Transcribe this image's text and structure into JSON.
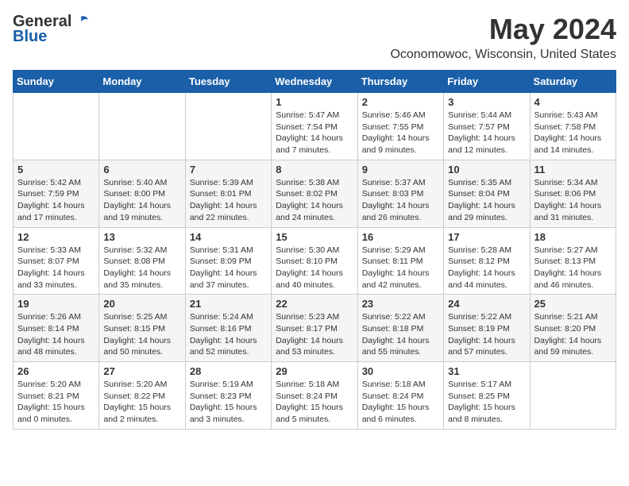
{
  "app": {
    "name_general": "General",
    "name_blue": "Blue"
  },
  "title": "May 2024",
  "location": "Oconomowoc, Wisconsin, United States",
  "days_of_week": [
    "Sunday",
    "Monday",
    "Tuesday",
    "Wednesday",
    "Thursday",
    "Friday",
    "Saturday"
  ],
  "weeks": [
    [
      {
        "day": "",
        "info": ""
      },
      {
        "day": "",
        "info": ""
      },
      {
        "day": "",
        "info": ""
      },
      {
        "day": "1",
        "info": "Sunrise: 5:47 AM\nSunset: 7:54 PM\nDaylight: 14 hours\nand 7 minutes."
      },
      {
        "day": "2",
        "info": "Sunrise: 5:46 AM\nSunset: 7:55 PM\nDaylight: 14 hours\nand 9 minutes."
      },
      {
        "day": "3",
        "info": "Sunrise: 5:44 AM\nSunset: 7:57 PM\nDaylight: 14 hours\nand 12 minutes."
      },
      {
        "day": "4",
        "info": "Sunrise: 5:43 AM\nSunset: 7:58 PM\nDaylight: 14 hours\nand 14 minutes."
      }
    ],
    [
      {
        "day": "5",
        "info": "Sunrise: 5:42 AM\nSunset: 7:59 PM\nDaylight: 14 hours\nand 17 minutes."
      },
      {
        "day": "6",
        "info": "Sunrise: 5:40 AM\nSunset: 8:00 PM\nDaylight: 14 hours\nand 19 minutes."
      },
      {
        "day": "7",
        "info": "Sunrise: 5:39 AM\nSunset: 8:01 PM\nDaylight: 14 hours\nand 22 minutes."
      },
      {
        "day": "8",
        "info": "Sunrise: 5:38 AM\nSunset: 8:02 PM\nDaylight: 14 hours\nand 24 minutes."
      },
      {
        "day": "9",
        "info": "Sunrise: 5:37 AM\nSunset: 8:03 PM\nDaylight: 14 hours\nand 26 minutes."
      },
      {
        "day": "10",
        "info": "Sunrise: 5:35 AM\nSunset: 8:04 PM\nDaylight: 14 hours\nand 29 minutes."
      },
      {
        "day": "11",
        "info": "Sunrise: 5:34 AM\nSunset: 8:06 PM\nDaylight: 14 hours\nand 31 minutes."
      }
    ],
    [
      {
        "day": "12",
        "info": "Sunrise: 5:33 AM\nSunset: 8:07 PM\nDaylight: 14 hours\nand 33 minutes."
      },
      {
        "day": "13",
        "info": "Sunrise: 5:32 AM\nSunset: 8:08 PM\nDaylight: 14 hours\nand 35 minutes."
      },
      {
        "day": "14",
        "info": "Sunrise: 5:31 AM\nSunset: 8:09 PM\nDaylight: 14 hours\nand 37 minutes."
      },
      {
        "day": "15",
        "info": "Sunrise: 5:30 AM\nSunset: 8:10 PM\nDaylight: 14 hours\nand 40 minutes."
      },
      {
        "day": "16",
        "info": "Sunrise: 5:29 AM\nSunset: 8:11 PM\nDaylight: 14 hours\nand 42 minutes."
      },
      {
        "day": "17",
        "info": "Sunrise: 5:28 AM\nSunset: 8:12 PM\nDaylight: 14 hours\nand 44 minutes."
      },
      {
        "day": "18",
        "info": "Sunrise: 5:27 AM\nSunset: 8:13 PM\nDaylight: 14 hours\nand 46 minutes."
      }
    ],
    [
      {
        "day": "19",
        "info": "Sunrise: 5:26 AM\nSunset: 8:14 PM\nDaylight: 14 hours\nand 48 minutes."
      },
      {
        "day": "20",
        "info": "Sunrise: 5:25 AM\nSunset: 8:15 PM\nDaylight: 14 hours\nand 50 minutes."
      },
      {
        "day": "21",
        "info": "Sunrise: 5:24 AM\nSunset: 8:16 PM\nDaylight: 14 hours\nand 52 minutes."
      },
      {
        "day": "22",
        "info": "Sunrise: 5:23 AM\nSunset: 8:17 PM\nDaylight: 14 hours\nand 53 minutes."
      },
      {
        "day": "23",
        "info": "Sunrise: 5:22 AM\nSunset: 8:18 PM\nDaylight: 14 hours\nand 55 minutes."
      },
      {
        "day": "24",
        "info": "Sunrise: 5:22 AM\nSunset: 8:19 PM\nDaylight: 14 hours\nand 57 minutes."
      },
      {
        "day": "25",
        "info": "Sunrise: 5:21 AM\nSunset: 8:20 PM\nDaylight: 14 hours\nand 59 minutes."
      }
    ],
    [
      {
        "day": "26",
        "info": "Sunrise: 5:20 AM\nSunset: 8:21 PM\nDaylight: 15 hours\nand 0 minutes."
      },
      {
        "day": "27",
        "info": "Sunrise: 5:20 AM\nSunset: 8:22 PM\nDaylight: 15 hours\nand 2 minutes."
      },
      {
        "day": "28",
        "info": "Sunrise: 5:19 AM\nSunset: 8:23 PM\nDaylight: 15 hours\nand 3 minutes."
      },
      {
        "day": "29",
        "info": "Sunrise: 5:18 AM\nSunset: 8:24 PM\nDaylight: 15 hours\nand 5 minutes."
      },
      {
        "day": "30",
        "info": "Sunrise: 5:18 AM\nSunset: 8:24 PM\nDaylight: 15 hours\nand 6 minutes."
      },
      {
        "day": "31",
        "info": "Sunrise: 5:17 AM\nSunset: 8:25 PM\nDaylight: 15 hours\nand 8 minutes."
      },
      {
        "day": "",
        "info": ""
      }
    ]
  ]
}
